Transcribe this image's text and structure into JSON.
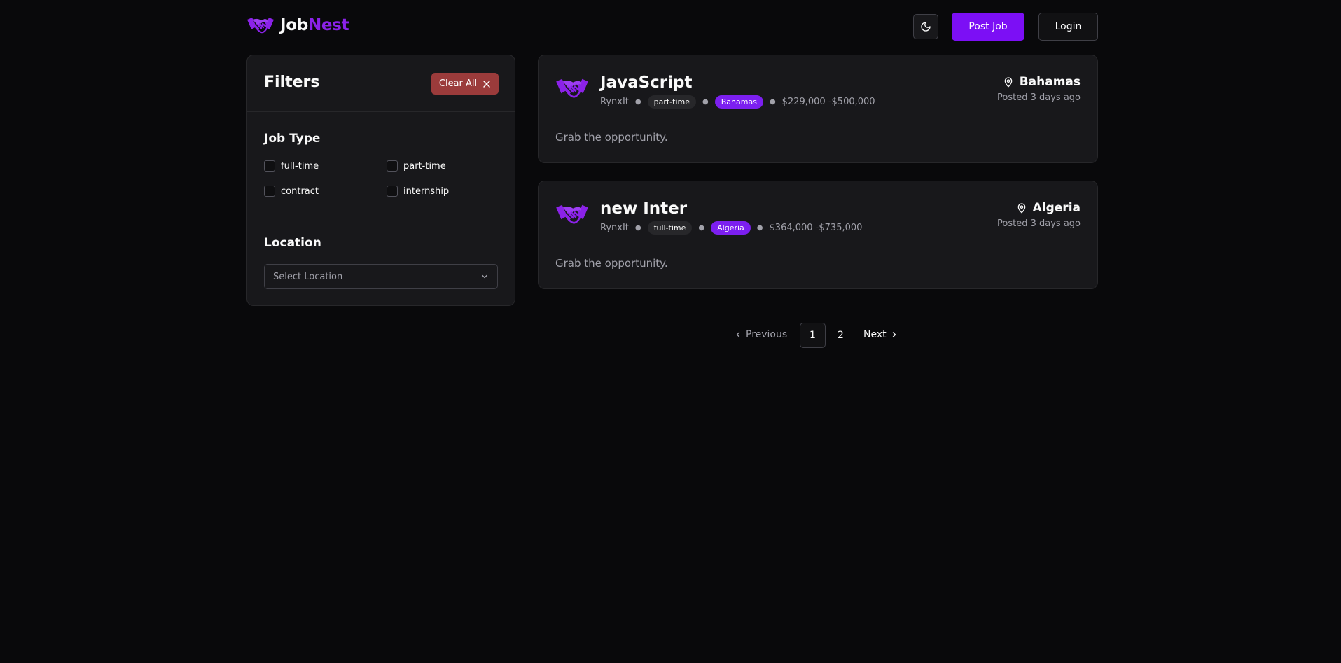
{
  "header": {
    "logo_job": "Job",
    "logo_nest": "Nest",
    "post_job_label": "Post Job",
    "login_label": "Login",
    "theme_icon": "moon-icon"
  },
  "filters": {
    "title": "Filters",
    "clear_all_label": "Clear All",
    "job_type_title": "Job Type",
    "job_types": [
      "full-time",
      "part-time",
      "contract",
      "internship"
    ],
    "location_title": "Location",
    "location_placeholder": "Select Location"
  },
  "jobs": [
    {
      "title": "JavaScript",
      "company": "RynxIt",
      "type": "part-time",
      "location_tag": "Bahamas",
      "salary": "$229,000 -$500,000",
      "location": "Bahamas",
      "posted": "Posted 3 days ago",
      "description": "Grab the opportunity."
    },
    {
      "title": "new Inter",
      "company": "RynxIt",
      "type": "full-time",
      "location_tag": "Algeria",
      "salary": "$364,000 -$735,000",
      "location": "Algeria",
      "posted": "Posted 3 days ago",
      "description": "Grab the opportunity."
    }
  ],
  "pagination": {
    "previous_label": "Previous",
    "pages": [
      "1",
      "2"
    ],
    "current_page": "1",
    "next_label": "Next"
  },
  "colors": {
    "background": "#09090b",
    "card": "#18181b",
    "accent": "#7c0ff5",
    "danger": "#9b3b3b"
  }
}
